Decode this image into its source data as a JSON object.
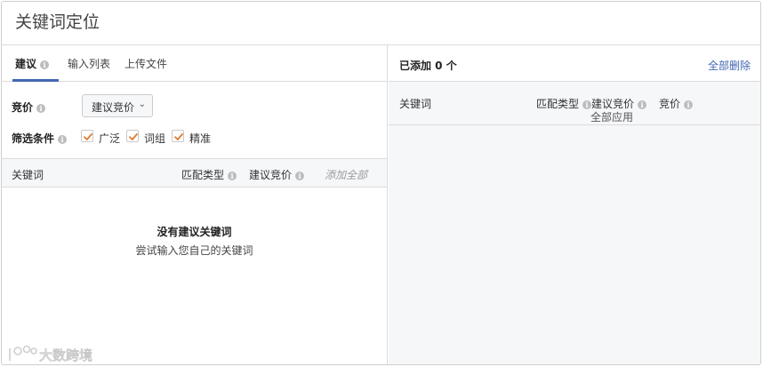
{
  "title": "关键词定位",
  "left": {
    "tabs": [
      {
        "label": "建议",
        "active": true
      },
      {
        "label": "输入列表",
        "active": false
      },
      {
        "label": "上传文件",
        "active": false
      }
    ],
    "bid_label": "竞价",
    "bid_select_value": "建议竞价",
    "filter_label": "筛选条件",
    "filters": [
      {
        "label": "广泛",
        "checked": true
      },
      {
        "label": "词组",
        "checked": true
      },
      {
        "label": "精准",
        "checked": true
      }
    ],
    "columns": {
      "keyword": "关键词",
      "match_type": "匹配类型",
      "suggested_bid": "建议竞价",
      "add_all": "添加全部"
    },
    "empty_title": "没有建议关键词",
    "empty_sub": "尝试输入您自己的关键词",
    "watermark": "大数跨境"
  },
  "right": {
    "added_label": "已添加 0 个",
    "delete_all": "全部删除",
    "columns": {
      "keyword": "关键词",
      "match_type": "匹配类型",
      "suggested_bid": "建议竞价",
      "apply_all": "全部应用",
      "bid": "竞价"
    }
  },
  "colors": {
    "accent": "#4267b2",
    "checkbox_check": "#e07b2e",
    "header_bg": "#f6f7f9"
  }
}
